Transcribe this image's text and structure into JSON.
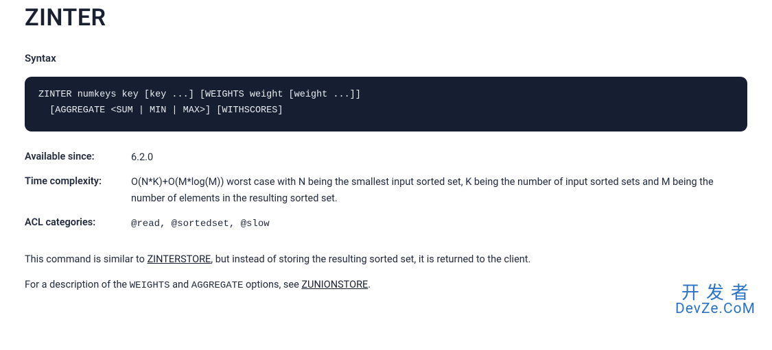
{
  "command": {
    "title": "ZINTER",
    "syntax_heading": "Syntax",
    "syntax_code": "ZINTER numkeys key [key ...] [WEIGHTS weight [weight ...]]\n  [AGGREGATE <SUM | MIN | MAX>] [WITHSCORES]"
  },
  "meta": {
    "available_since_label": "Available since:",
    "available_since_value": "6.2.0",
    "time_complexity_label": "Time complexity:",
    "time_complexity_value": "O(N*K)+O(M*log(M)) worst case with N being the smallest input sorted set, K being the number of input sorted sets and M being the number of elements in the resulting sorted set.",
    "acl_label": "ACL categories:",
    "acl_value": "@read, @sortedset, @slow"
  },
  "body": {
    "p1_prefix": "This command is similar to ",
    "p1_link": "ZINTERSTORE",
    "p1_suffix": ", but instead of storing the resulting sorted set, it is returned to the client.",
    "p2_prefix": "For a description of the ",
    "p2_code1": "WEIGHTS",
    "p2_mid1": " and ",
    "p2_code2": "AGGREGATE",
    "p2_mid2": " options, see ",
    "p2_link": "ZUNIONSTORE",
    "p2_suffix": "."
  },
  "watermark": {
    "line1": "开发者",
    "line2": "DevZe.CoM"
  }
}
